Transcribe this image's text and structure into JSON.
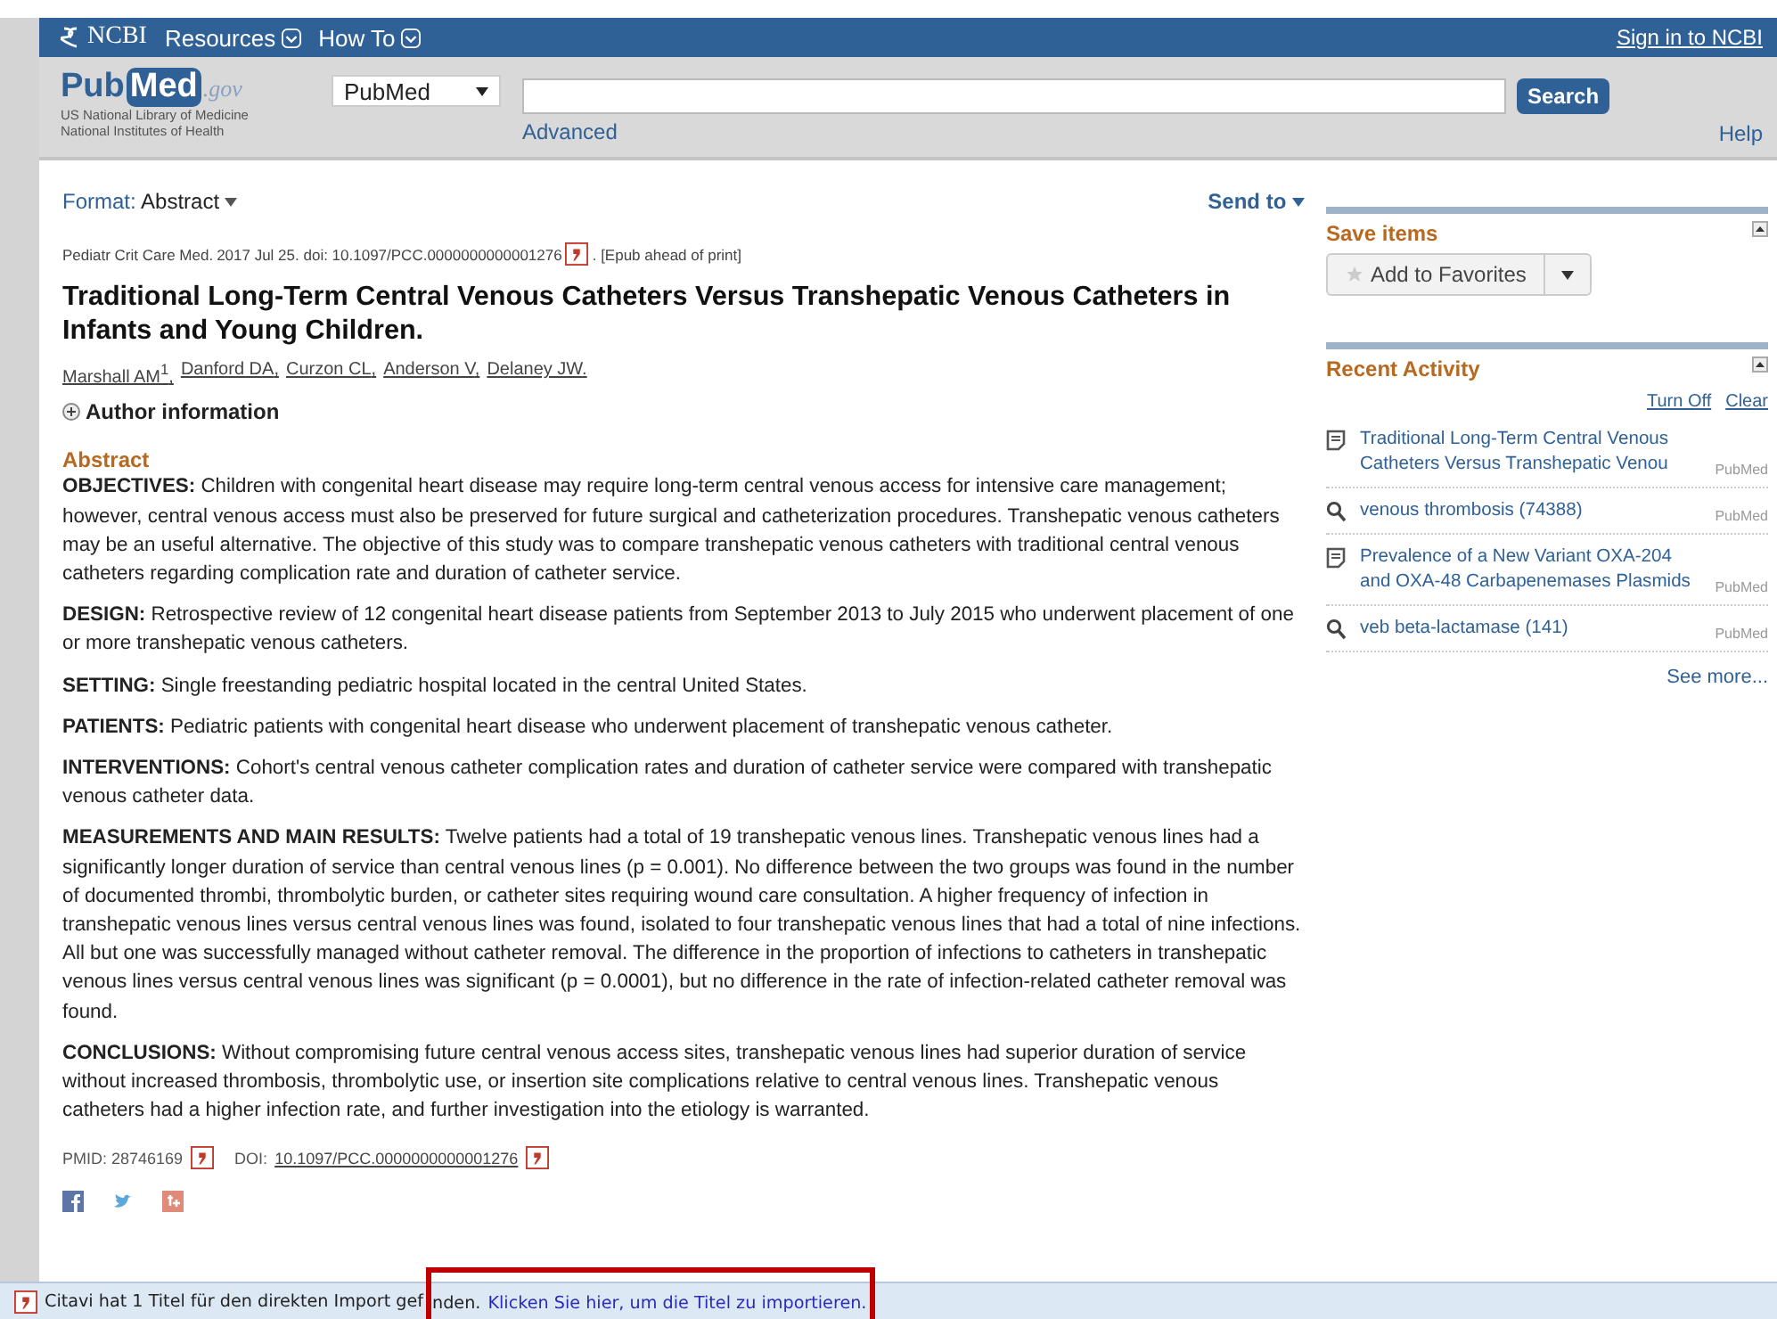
{
  "header": {
    "brand": "NCBI",
    "menus": [
      "Resources",
      "How To"
    ],
    "sign_in": "Sign in to NCBI"
  },
  "search": {
    "logo_main": "Pub",
    "logo_med": "Med",
    "logo_gov": ".gov",
    "org_lines": [
      "US National Library of Medicine",
      "National Institutes of Health"
    ],
    "database": "PubMed",
    "button": "Search",
    "advanced": "Advanced",
    "help": "Help"
  },
  "article": {
    "format_label": "Format:",
    "format_value": "Abstract",
    "send_to": "Send to",
    "journal": "Pediatr Crit Care Med.",
    "citation": "2017 Jul 25. doi: 10.1097/PCC.0000000000001276",
    "epub": ". [Epub ahead of print]",
    "title": "Traditional Long-Term Central Venous Catheters Versus Transhepatic Venous Catheters in Infants and Young Children.",
    "authors": [
      {
        "name": "Marshall AM",
        "sup": "1",
        "sep": ","
      },
      {
        "name": "Danford DA",
        "sep": ","
      },
      {
        "name": "Curzon CL",
        "sep": ","
      },
      {
        "name": "Anderson V",
        "sep": ","
      },
      {
        "name": "Delaney JW",
        "sep": "."
      }
    ],
    "author_info": "Author information",
    "expanded": false,
    "abstract_heading": "Abstract",
    "paragraphs": [
      "**OBJECTIVES:** Children with congenital heart disease may require long-term central venous access for intensive care management; however, central venous access must also be preserved for future surgical and catheterization procedures. Transhepatic venous catheters may be an useful alternative. The objective of this study was to compare transhepatic venous catheters with traditional central venous catheters regarding complication rate and duration of catheter service.",
      "**DESIGN:** Retrospective review of 12 congenital heart disease patients from September 2013 to July 2015 who underwent placement of one or more transhepatic venous catheters.",
      "**SETTING:** Single freestanding pediatric hospital located in the central United States.",
      "**PATIENTS:** Pediatric patients with congenital heart disease who underwent placement of transhepatic venous catheter.",
      "**INTERVENTIONS:** Cohort's central venous catheter complication rates and duration of catheter service were compared with transhepatic venous catheter data.",
      "**MEASUREMENTS AND MAIN RESULTS:** Twelve patients had a total of 19 transhepatic venous lines. Transhepatic venous lines had a significantly longer duration of service than central venous lines (p = 0.001). No difference between the two groups was found in the number of documented thrombi, thrombolytic burden, or catheter sites requiring wound care consultation. A higher frequency of infection in transhepatic venous lines versus central venous lines was found, isolated to four transhepatic venous lines that had a total of nine infections. All but one was successfully managed without catheter removal. The difference in the proportion of infections to catheters in transhepatic venous lines versus central venous lines was significant (p = 0.0001), but no difference in the rate of infection-related catheter removal was found.",
      "**CONCLUSIONS:** Without compromising future central venous access sites, transhepatic venous lines had superior duration of service without increased thrombosis, thrombolytic use, or insertion site complications relative to central venous lines. Transhepatic venous catheters had a higher infection rate, and further investigation into the etiology is warranted."
    ],
    "pmid": "PMID: 28746169",
    "doi_label": "DOI:",
    "doi": "10.1097/PCC.0000000000001276"
  },
  "sidebar": {
    "save_title": "Save items",
    "favorites": "Add to Favorites",
    "recent_title": "Recent Activity",
    "turn_off": "Turn Off",
    "clear": "Clear",
    "items": [
      {
        "kind": "document",
        "text": "Traditional Long-Term Central Venous Catheters Versus Transhepatic Venou",
        "source": "PubMed"
      },
      {
        "kind": "search",
        "text": "venous thrombosis (74388)",
        "source": "PubMed"
      },
      {
        "kind": "document",
        "text": "Prevalence of a New Variant OXA-204 and OXA-48 Carbapenemases Plasmids",
        "source": "PubMed"
      },
      {
        "kind": "search",
        "text": "veb beta-lactamase (141)",
        "source": "PubMed"
      }
    ],
    "see_more": "See more..."
  },
  "status_bar": {
    "message": "Citavi hat 1 Titel für den direkten Import gef",
    "message_rest": "nden.",
    "link": "Klicken Sie hier, um die Titel zu importieren."
  }
}
